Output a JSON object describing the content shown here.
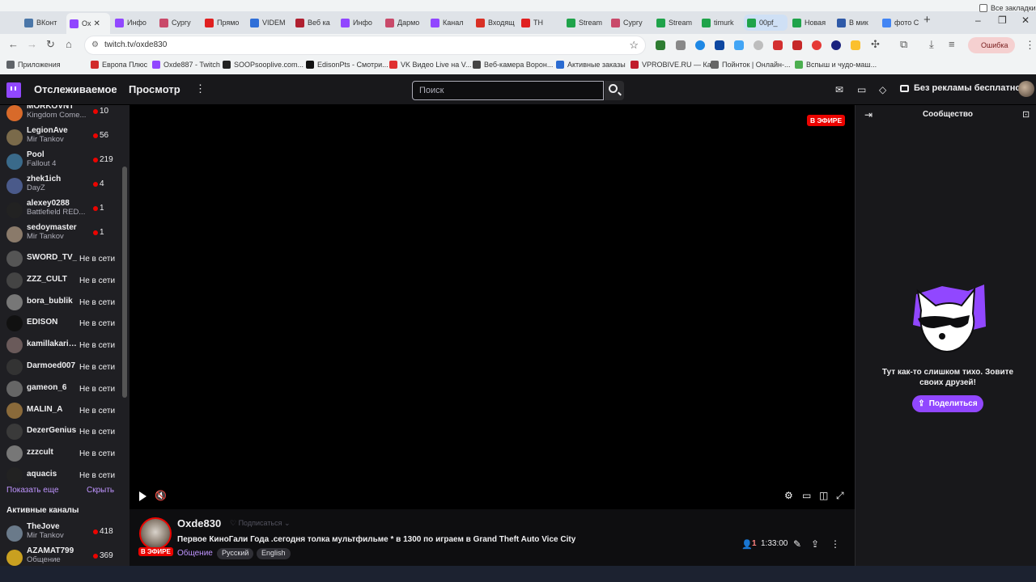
{
  "browser": {
    "tabs": [
      {
        "label": "ВКонт",
        "color": "#4a76a8"
      },
      {
        "label": "Ox",
        "color": "#9147ff",
        "active": true
      },
      {
        "label": "Инфо",
        "color": "#9147ff"
      },
      {
        "label": "Сургу",
        "color": "#c94a6a"
      },
      {
        "label": "Прямо",
        "color": "#e02020"
      },
      {
        "label": "VIDEM",
        "color": "#2f6fd8"
      },
      {
        "label": "Веб ка",
        "color": "#b02030"
      },
      {
        "label": "Инфо",
        "color": "#9147ff"
      },
      {
        "label": "Дармо",
        "color": "#c94a6a"
      },
      {
        "label": "Канал",
        "color": "#9147ff"
      },
      {
        "label": "Входящ",
        "color": "#d93025"
      },
      {
        "label": "ТН",
        "color": "#e02020"
      },
      {
        "label": "Stream",
        "color": "#1fa34a"
      },
      {
        "label": "Сургу",
        "color": "#c94a6a"
      },
      {
        "label": "Stream",
        "color": "#1fa34a"
      },
      {
        "label": "timurk",
        "color": "#1fa34a"
      },
      {
        "label": "00pf_",
        "color": "#1fa34a",
        "highlight": true
      },
      {
        "label": "Новая",
        "color": "#1fa34a"
      },
      {
        "label": "В мик",
        "color": "#2f5aa8"
      },
      {
        "label": "фото С",
        "color": "#4285f4"
      }
    ],
    "url": "twitch.tv/oxde830",
    "error_label": "Ошибка",
    "bookmarks": [
      {
        "label": "Приложения",
        "color": "#5f6368"
      },
      {
        "label": "Европа Плюс",
        "color": "#d12c2c"
      },
      {
        "label": "Oxde887 - Twitch",
        "color": "#9147ff"
      },
      {
        "label": "SOOPsooplive.com...",
        "color": "#222222"
      },
      {
        "label": "EdisonPts - Смотри...",
        "color": "#111111"
      },
      {
        "label": "VK Видео Live на V...",
        "color": "#e03030"
      },
      {
        "label": "Веб-камера Ворон...",
        "color": "#444444"
      },
      {
        "label": "Активные заказы",
        "color": "#2a6bd1"
      },
      {
        "label": "VPROBIVE.RU — Ка...",
        "color": "#c01c2c"
      },
      {
        "label": "Пойнток | Онлайн-...",
        "color": "#666666"
      },
      {
        "label": "Вспыш и чудо-маш...",
        "color": "#4caf50"
      }
    ],
    "all_bookmarks": "Все закладки"
  },
  "nav": {
    "following": "Отслеживаемое",
    "browse": "Просмотр",
    "search_placeholder": "Поиск",
    "no_ads": "Без рекламы бесплатно"
  },
  "sidebar": {
    "channels": [
      {
        "name": "MORKOVNT",
        "game": "Kingdom Come...",
        "viewers": "10",
        "live": true,
        "avatar": "#d86a2a"
      },
      {
        "name": "LegionAve",
        "game": "Mir Tankov",
        "viewers": "56",
        "live": true,
        "avatar": "#7a6a4a"
      },
      {
        "name": "Pool",
        "game": "Fallout 4",
        "viewers": "219",
        "live": true,
        "avatar": "#3a6a8a"
      },
      {
        "name": "zhek1ich",
        "game": "DayZ",
        "viewers": "4",
        "live": true,
        "avatar": "#4a5a8a"
      },
      {
        "name": "alexey0288",
        "game": "Battlefield RED...",
        "viewers": "1",
        "live": true,
        "avatar": "#222222"
      },
      {
        "name": "sedoymaster",
        "game": "Mir Tankov",
        "viewers": "1",
        "live": true,
        "avatar": "#8a7a6a"
      },
      {
        "name": "SWORD_TV_",
        "status": "Не в сети",
        "avatar": "#555555"
      },
      {
        "name": "ZZZ_CULT",
        "status": "Не в сети",
        "avatar": "#444444"
      },
      {
        "name": "bora_bublik",
        "status": "Не в сети",
        "avatar": "#777777"
      },
      {
        "name": "EDISON",
        "status": "Не в сети",
        "avatar": "#111111"
      },
      {
        "name": "kamillakarie...",
        "status": "Не в сети",
        "avatar": "#6a5a5a"
      },
      {
        "name": "Darmoed007",
        "status": "Не в сети",
        "avatar": "#333333"
      },
      {
        "name": "gameon_6",
        "status": "Не в сети",
        "avatar": "#666666"
      },
      {
        "name": "MALIN_A",
        "status": "Не в сети",
        "avatar": "#8a6a3a"
      },
      {
        "name": "DezerGenius",
        "status": "Не в сети",
        "avatar": "#3a3a3a"
      },
      {
        "name": "zzzcult",
        "status": "Не в сети",
        "avatar": "#777777"
      },
      {
        "name": "aquacis",
        "status": "Не в сети",
        "avatar": "#222222"
      }
    ],
    "show_more": "Показать еще",
    "hide": "Скрыть",
    "active_heading": "Активные каналы",
    "active_channels": [
      {
        "name": "TheJove",
        "game": "Mir Tankov",
        "viewers": "418",
        "live": true,
        "avatar": "#6a7a8a"
      },
      {
        "name": "AZAMAT799",
        "game": "Общение",
        "viewers": "369",
        "live": true,
        "avatar": "#c9a020"
      }
    ]
  },
  "player": {
    "live_badge": "В ЭФИРЕ"
  },
  "stream": {
    "streamer": "Oxde830",
    "follow": "Подписаться",
    "avatar_live": "В ЭФИРЕ",
    "title": "Первое КиноГали Года .сегодня толка мультфильме * в 1300 по играем в Grand Theft Auto Vice City",
    "category": "Общение",
    "tags": [
      "Русский",
      "English"
    ],
    "viewers": "1",
    "uptime": "1:33:00"
  },
  "chat": {
    "title": "Сообщество",
    "empty_text": "Тут как-то слишком тихо. Зовите своих друзей!",
    "share": "Поделиться"
  }
}
